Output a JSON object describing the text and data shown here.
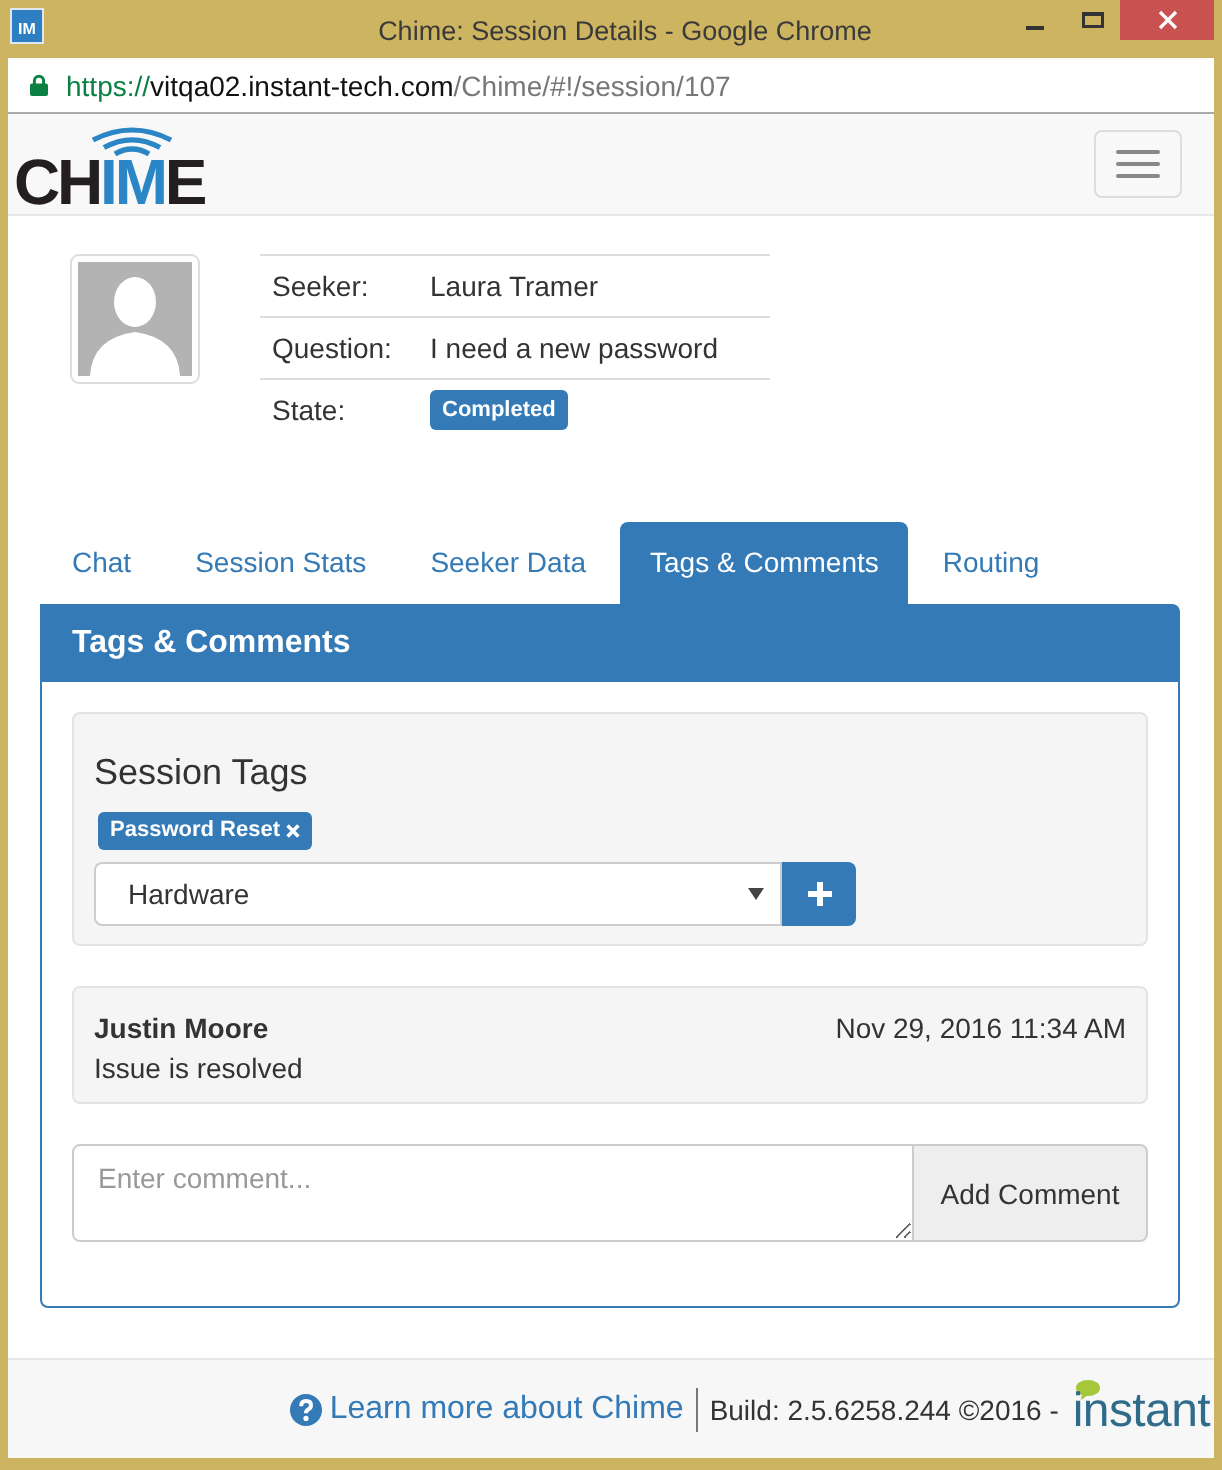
{
  "window": {
    "title": "Chime: Session Details - Google Chrome",
    "icon_label": "IM",
    "url": {
      "scheme": "https://",
      "host": "vitqa02.instant-tech.com",
      "path": "/Chime/#!/session/107"
    }
  },
  "navbar": {
    "logo": [
      {
        "text": "CH",
        "accent": false
      },
      {
        "text": "IM",
        "accent": true
      },
      {
        "text": "E",
        "accent": false
      }
    ]
  },
  "session": {
    "rows": [
      {
        "kind": "text",
        "label": "Seeker:",
        "value": "Laura Tramer"
      },
      {
        "kind": "text",
        "label": "Question:",
        "value": "I need a new password"
      },
      {
        "kind": "badge",
        "label": "State:",
        "value": "Completed"
      }
    ]
  },
  "tabs": [
    {
      "label": "Chat",
      "selected": false
    },
    {
      "label": "Session Stats",
      "selected": false
    },
    {
      "label": "Seeker Data",
      "selected": false
    },
    {
      "label": "Tags & Comments",
      "selected": true
    },
    {
      "label": "Routing",
      "selected": false
    }
  ],
  "panel": {
    "title": "Tags & Comments",
    "session_tags": {
      "title": "Session Tags",
      "tags": [
        {
          "label": "Password Reset"
        }
      ],
      "select_value": "Hardware"
    },
    "comments": [
      {
        "author": "Justin Moore",
        "time": "Nov 29, 2016 11:34 AM",
        "text": "Issue is resolved"
      }
    ],
    "comment_input": {
      "placeholder": "Enter comment...",
      "button": "Add Comment"
    }
  },
  "footer": {
    "help_link": "Learn more about Chime",
    "build": "Build: 2.5.6258.244 ©2016 -",
    "brand": "instant"
  }
}
